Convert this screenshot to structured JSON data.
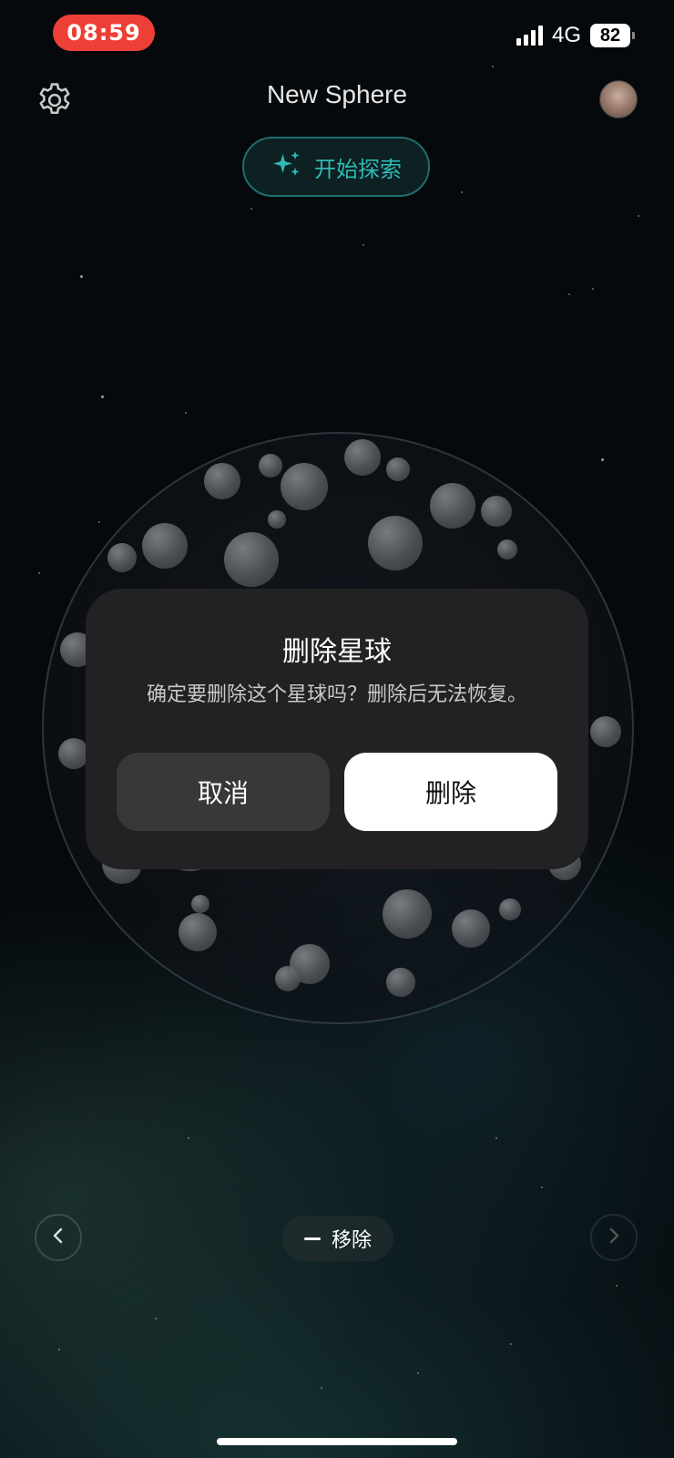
{
  "status_bar": {
    "time": "08:59",
    "network": "4G",
    "battery": "82",
    "time_pill_color": "#ee3f37"
  },
  "header": {
    "title": "New Sphere",
    "settings_icon": "gear-icon",
    "avatar_icon": "avatar"
  },
  "explore_button": {
    "label": "开始探索",
    "icon": "sparkles-icon",
    "accent": "#2fb9b7"
  },
  "dialog": {
    "title": "删除星球",
    "message": "确定要删除这个星球吗？删除后无法恢复。",
    "cancel_label": "取消",
    "delete_label": "删除"
  },
  "bottom_bar": {
    "prev_icon": "chevron-left-icon",
    "next_icon": "chevron-right-icon",
    "remove_label": "移除",
    "remove_icon": "minus-icon"
  }
}
